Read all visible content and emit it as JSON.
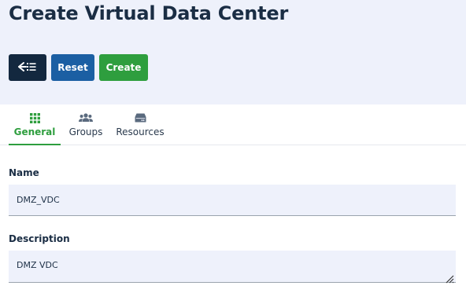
{
  "header": {
    "title": "Create Virtual Data Center"
  },
  "toolbar": {
    "back_icon": "back-to-list-icon",
    "reset_label": "Reset",
    "create_label": "Create"
  },
  "tabs": [
    {
      "label": "General",
      "icon": "grid-icon",
      "active": true
    },
    {
      "label": "Groups",
      "icon": "users-icon",
      "active": false
    },
    {
      "label": "Resources",
      "icon": "server-icon",
      "active": false
    }
  ],
  "form": {
    "name": {
      "label": "Name",
      "value": "DMZ_VDC"
    },
    "description": {
      "label": "Description",
      "value": "DMZ VDC"
    }
  },
  "colors": {
    "header_bg": "#eef1fb",
    "primary_dark": "#13283f",
    "reset_blue": "#1b5fa3",
    "create_green": "#2e9e3e",
    "tab_active": "#2e9e3e"
  }
}
